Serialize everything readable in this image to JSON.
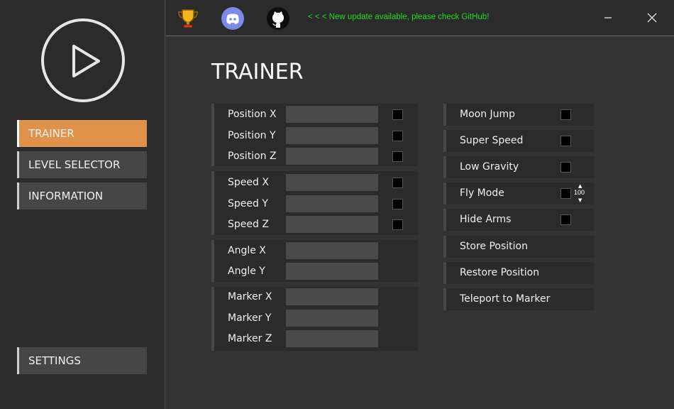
{
  "topbar": {
    "update_message": "< < < New update available, please check GitHub!",
    "icons": [
      "trophy-icon",
      "discord-icon",
      "github-icon"
    ],
    "message_color": "#22dd22"
  },
  "sidebar": {
    "items": [
      {
        "label": "TRAINER",
        "active": true
      },
      {
        "label": "LEVEL SELECTOR",
        "active": false
      },
      {
        "label": "INFORMATION",
        "active": false
      }
    ],
    "settings_label": "SETTINGS",
    "accent": "#e0924b"
  },
  "main": {
    "title": "TRAINER",
    "position": {
      "x": "Position X",
      "y": "Position Y",
      "z": "Position Z"
    },
    "speed": {
      "x": "Speed X",
      "y": "Speed Y",
      "z": "Speed Z"
    },
    "angle": {
      "x": "Angle X",
      "y": "Angle Y"
    },
    "marker": {
      "x": "Marker X",
      "y": "Marker Y",
      "z": "Marker Z"
    },
    "toggles": {
      "moon_jump": "Moon Jump",
      "super_speed": "Super Speed",
      "low_gravity": "Low Gravity",
      "fly_mode": "Fly Mode",
      "hide_arms": "Hide Arms"
    },
    "fly_speed_value": "100",
    "actions": {
      "store_position": "Store Position",
      "restore_position": "Restore Position",
      "teleport_to_marker": "Teleport to Marker"
    }
  }
}
